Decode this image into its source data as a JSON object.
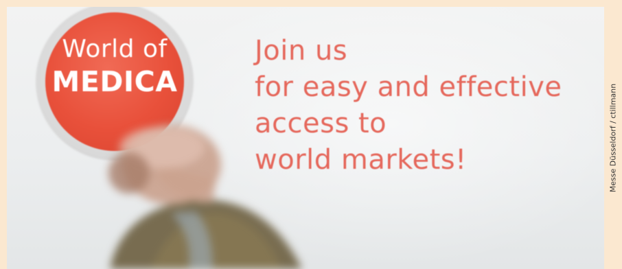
{
  "logo": {
    "line1": "World of",
    "line2": "MEDICA"
  },
  "slogan": {
    "lines": [
      "Join us",
      "for easy and effective",
      "access to",
      "world markets!"
    ]
  },
  "credit": "Messe Düsseldorf / ctillmann",
  "colors": {
    "frame": "#fbe8d0",
    "logo_red": "#e8503a",
    "slogan_text": "#e5685c",
    "wall": "#eef0f0"
  }
}
